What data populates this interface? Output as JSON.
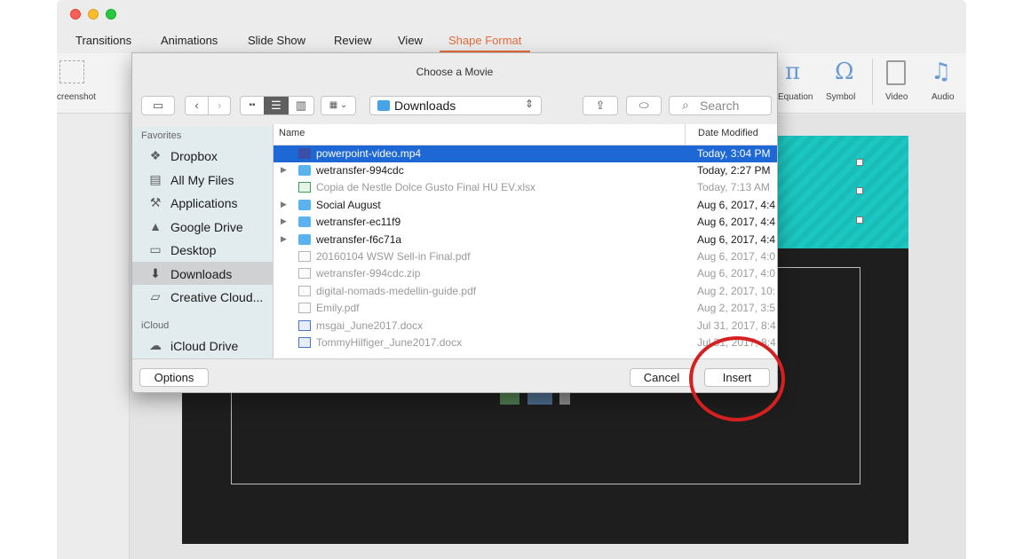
{
  "ribbon": {
    "tabs": [
      "Transitions",
      "Animations",
      "Slide Show",
      "Review",
      "View",
      "Shape Format"
    ],
    "active_tab": "Shape Format",
    "items": {
      "screenshot": "creenshot",
      "equation": "Equation",
      "symbol": "Symbol",
      "video": "Video",
      "audio": "Audio"
    },
    "icons": {
      "equation": "π",
      "symbol": "Ω",
      "audio": "♫"
    }
  },
  "dialog": {
    "title": "Choose a Movie",
    "location": "Downloads",
    "search_placeholder": "Search",
    "sidebar": {
      "favorites_heading": "Favorites",
      "favorites": [
        {
          "label": "Dropbox",
          "icon": "dropbox-icon"
        },
        {
          "label": "All My Files",
          "icon": "all-files-icon"
        },
        {
          "label": "Applications",
          "icon": "applications-icon"
        },
        {
          "label": "Google Drive",
          "icon": "google-drive-icon"
        },
        {
          "label": "Desktop",
          "icon": "desktop-icon"
        },
        {
          "label": "Downloads",
          "icon": "downloads-icon",
          "selected": true
        },
        {
          "label": "Creative Cloud...",
          "icon": "folder-icon"
        }
      ],
      "icloud_heading": "iCloud",
      "icloud": [
        {
          "label": "iCloud Drive",
          "icon": "cloud-icon"
        }
      ]
    },
    "columns": {
      "name": "Name",
      "date": "Date Modified"
    },
    "files": [
      {
        "name": "powerpoint-video.mp4",
        "date": "Today, 3:04 PM",
        "type": "video",
        "selected": true
      },
      {
        "name": "wetransfer-994cdc",
        "date": "Today, 2:27 PM",
        "type": "folder"
      },
      {
        "name": "Copia de Nestle Dolce Gusto Final HU EV.xlsx",
        "date": "Today, 7:13 AM",
        "type": "excel",
        "dim": true
      },
      {
        "name": "Social August",
        "date": "Aug 6, 2017, 4:4",
        "type": "folder"
      },
      {
        "name": "wetransfer-ec11f9",
        "date": "Aug 6, 2017, 4:4",
        "type": "folder"
      },
      {
        "name": "wetransfer-f6c71a",
        "date": "Aug 6, 2017, 4:4",
        "type": "folder"
      },
      {
        "name": "20160104 WSW Sell-in Final.pdf",
        "date": "Aug 6, 2017, 4:0",
        "type": "doc",
        "dim": true
      },
      {
        "name": "wetransfer-994cdc.zip",
        "date": "Aug 6, 2017, 4:0",
        "type": "doc",
        "dim": true
      },
      {
        "name": "digital-nomads-medellin-guide.pdf",
        "date": "Aug 2, 2017, 10:",
        "type": "doc",
        "dim": true
      },
      {
        "name": "Emily.pdf",
        "date": "Aug 2, 2017, 3:5",
        "type": "doc",
        "dim": true
      },
      {
        "name": "msgai_June2017.docx",
        "date": "Jul 31, 2017, 8:4",
        "type": "word",
        "dim": true
      },
      {
        "name": "TommyHilfiger_June2017.docx",
        "date": "Jul 31, 2017, 8:4",
        "type": "word",
        "dim": true
      }
    ],
    "buttons": {
      "options": "Options",
      "cancel": "Cancel",
      "insert": "Insert"
    }
  },
  "colors": {
    "accent_tab": "#e36b3a",
    "selection": "#1e68d6",
    "highlight_circle": "#d62020",
    "slide_banner": "#1cc7c2"
  }
}
